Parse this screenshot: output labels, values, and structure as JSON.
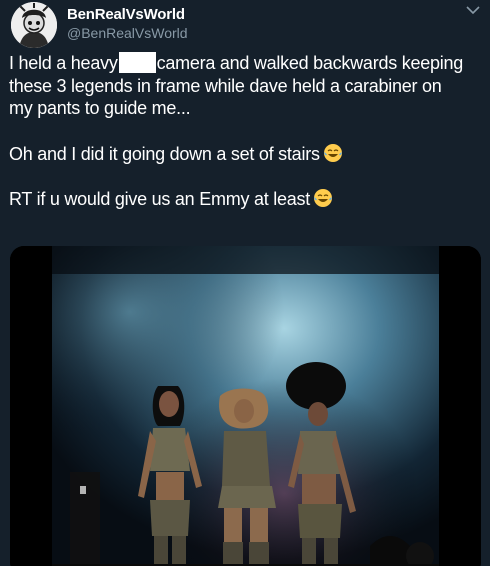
{
  "tweet": {
    "display_name": "BenRealVsWorld",
    "handle": "@BenRealVsWorld",
    "icons": {
      "avatar": "avatar-cartoon",
      "more": "chevron-down-icon",
      "emoji": "face-with-tears-of-joy-emoji",
      "media": "video-still"
    },
    "text": {
      "line1_before": "I held a heavy",
      "line1_after": "camera and walked backwards keeping",
      "line2": "these 3 legends in frame while dave held a carabiner on",
      "line3": "my pants to guide me...",
      "line4": "Oh and I did it going down a set of stairs",
      "line5": "RT if u would give us an Emmy at least"
    }
  },
  "colors": {
    "background": "#15202b",
    "secondary_text": "#8899a6",
    "primary_text": "#ffffff"
  }
}
